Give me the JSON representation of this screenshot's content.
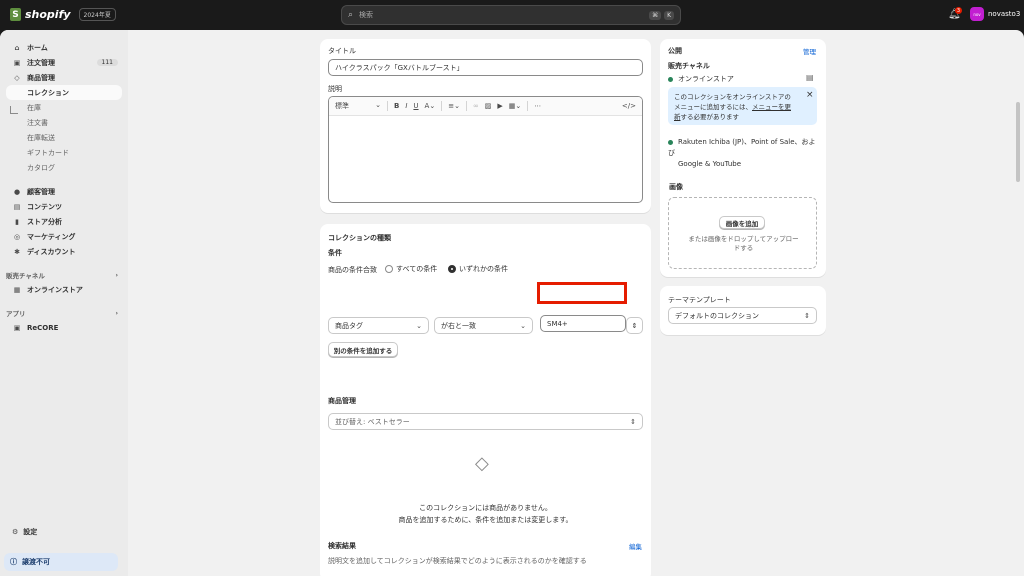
{
  "topbar": {
    "logo_text": "shopify",
    "year_badge": "2024年夏",
    "search_placeholder": "検索",
    "shortcut_1": "⌘",
    "shortcut_2": "K",
    "notification_count": "3",
    "avatar_initials": "nov",
    "store_name": "novasto3"
  },
  "sidebar": {
    "items": [
      {
        "icon": "home-icon",
        "label": "ホーム"
      },
      {
        "icon": "inbox-icon",
        "label": "注文管理",
        "count": "111"
      },
      {
        "icon": "tag-icon",
        "label": "商品管理"
      }
    ],
    "products_sub": [
      {
        "label": "コレクション",
        "active": true
      },
      {
        "label": "在庫"
      },
      {
        "label": "注文書"
      },
      {
        "label": "在庫転送"
      },
      {
        "label": "ギフトカード"
      },
      {
        "label": "カタログ"
      }
    ],
    "items2": [
      {
        "icon": "person-icon",
        "label": "顧客管理"
      },
      {
        "icon": "content-icon",
        "label": "コンテンツ"
      },
      {
        "icon": "chart-icon",
        "label": "ストア分析"
      },
      {
        "icon": "target-icon",
        "label": "マーケティング"
      },
      {
        "icon": "discount-icon",
        "label": "ディスカウント"
      }
    ],
    "sales_section": "販売チャネル",
    "online_store": "オンラインストア",
    "apps_section": "アプリ",
    "recore": "ReCORE",
    "settings": "設定",
    "transfer_status": "譲渡不可"
  },
  "title_card": {
    "title_label": "タイトル",
    "title_value": "ハイクラスパック「GXバトルブースト」",
    "desc_label": "説明",
    "format_select": "標準"
  },
  "type_card": {
    "heading": "コレクションの種類",
    "conditions_label": "条件",
    "match_label": "商品の条件合致",
    "option_all": "すべての条件",
    "option_any": "いずれかの条件",
    "field_select": "商品タグ",
    "operator_select": "が右と一致",
    "value": "SM4+",
    "add_condition": "別の条件を追加する"
  },
  "products_card": {
    "heading": "商品管理",
    "sort_select": "並び替え: ベストセラー",
    "empty_line1": "このコレクションには商品がありません。",
    "empty_line2": "商品を追加するために、条件を追加または変更します。"
  },
  "seo_card": {
    "heading": "検索結果",
    "edit": "編集",
    "body": "説明文を追加してコレクションが検索結果でどのように表示されるのかを確認する"
  },
  "publish_card": {
    "heading": "公開",
    "manage": "管理",
    "channels_label": "販売チャネル",
    "online_store": "オンラインストア",
    "banner_text_1": "このコレクションをオンラインストアの",
    "banner_text_2": "メニューに追加するには、",
    "banner_link_1": "メニューを更",
    "banner_link_2": "新",
    "banner_text_3": "する必要があります",
    "other_channels_1": "Rakuten Ichiba (JP)、Point of Sale、および",
    "other_channels_2": "Google & YouTube"
  },
  "image_card": {
    "heading": "画像",
    "add_button": "画像を追加",
    "drop_hint_1": "または画像をドロップしてアップロー",
    "drop_hint_2": "ドする"
  },
  "template_card": {
    "heading": "テーマテンプレート",
    "select": "デフォルトのコレクション"
  },
  "colors": {
    "accent": "#005bd3",
    "highlight": "#e51c00",
    "status_green": "#29845a"
  }
}
